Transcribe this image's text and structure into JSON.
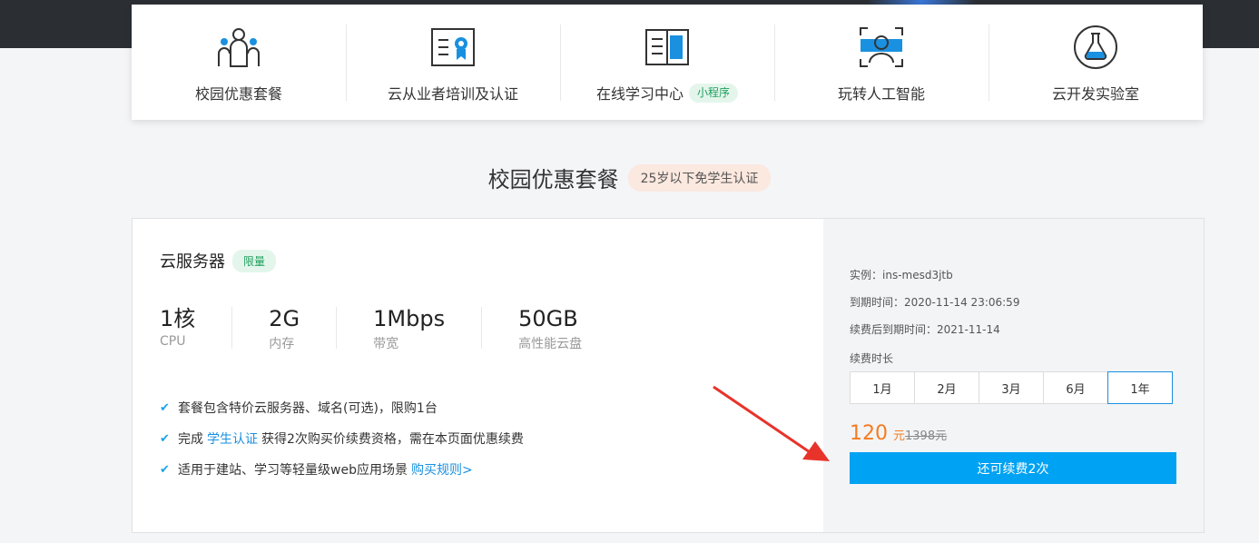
{
  "nav": {
    "items": [
      {
        "label": "校园优惠套餐",
        "icon": "users-group-icon"
      },
      {
        "label": "云从业者培训及认证",
        "icon": "certificate-icon"
      },
      {
        "label": "在线学习中心",
        "icon": "book-icon",
        "badge": "小程序"
      },
      {
        "label": "玩转人工智能",
        "icon": "face-scan-icon"
      },
      {
        "label": "云开发实验室",
        "icon": "flask-icon"
      }
    ]
  },
  "section": {
    "title": "校园优惠套餐",
    "badge": "25岁以下免学生认证"
  },
  "product": {
    "title": "云服务器",
    "badge": "限量",
    "specs": [
      {
        "value": "1核",
        "label": "CPU"
      },
      {
        "value": "2G",
        "label": "内存"
      },
      {
        "value": "1Mbps",
        "label": "带宽"
      },
      {
        "value": "50GB",
        "label": "高性能云盘"
      }
    ],
    "features": {
      "f1": "套餐包含特价云服务器、域名(可选)，限购1台",
      "f2_pre": "完成",
      "f2_link": "学生认证",
      "f2_post": "获得2次购买价续费资格，需在本页面优惠续费",
      "f3_pre": "适用于建站、学习等轻量级web应用场景",
      "f3_link": "购买规则>"
    }
  },
  "renewal": {
    "instance": "实例：ins-mesd3jtb",
    "expire": "到期时间：2020-11-14 23:06:59",
    "after_expire": "续费后到期时间：2021-11-14",
    "duration_label": "续费时长",
    "durations": [
      "1月",
      "2月",
      "3月",
      "6月",
      "1年"
    ],
    "selected_duration": "1年",
    "price": "120",
    "unit": "元",
    "original_price": "1398元",
    "button": "还可续费2次"
  },
  "colors": {
    "accent": "#00a2f3",
    "price": "#f57b21",
    "green_badge": "#1f9e5c",
    "arrow": "#e8332b"
  }
}
